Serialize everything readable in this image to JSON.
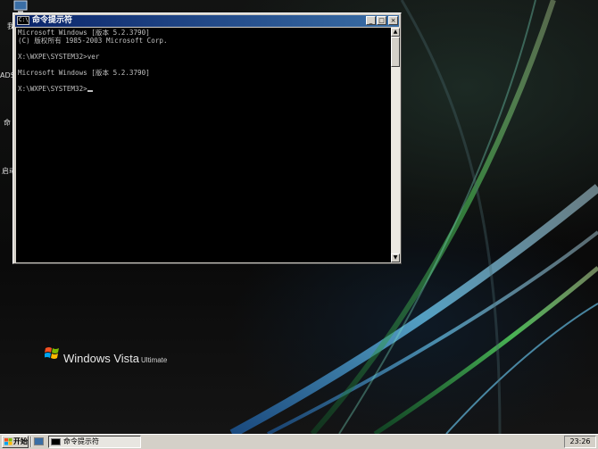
{
  "desktop": {
    "icon_labels": [
      "我",
      "ADS",
      "命",
      "启动"
    ],
    "vista_logo": {
      "brand": "Windows Vista",
      "edition": "Ultimate"
    }
  },
  "cmd_window": {
    "title": "命令提示符",
    "title_icon_text": "C:\\",
    "buttons": {
      "minimize": "_",
      "maximize": "□",
      "close": "×"
    },
    "console_lines": [
      "Microsoft Windows [版本 5.2.3790]",
      "(C) 版权所有 1985-2003 Microsoft Corp.",
      "",
      "X:\\WXPE\\SYSTEM32>ver",
      "",
      "Microsoft Windows [版本 5.2.3790]",
      "",
      "X:\\WXPE\\SYSTEM32>"
    ],
    "scrollbar": {
      "up_arrow": "▲",
      "down_arrow": "▼"
    }
  },
  "taskbar": {
    "start_label": "开始",
    "tasks": [
      {
        "label": "命令提示符"
      }
    ],
    "clock": "23:26"
  },
  "colors": {
    "titlebar_start": "#0a246a",
    "titlebar_end": "#3a6ea5",
    "console_bg": "#000000",
    "console_text": "#c0c0c0",
    "chrome": "#d4d0c8"
  }
}
